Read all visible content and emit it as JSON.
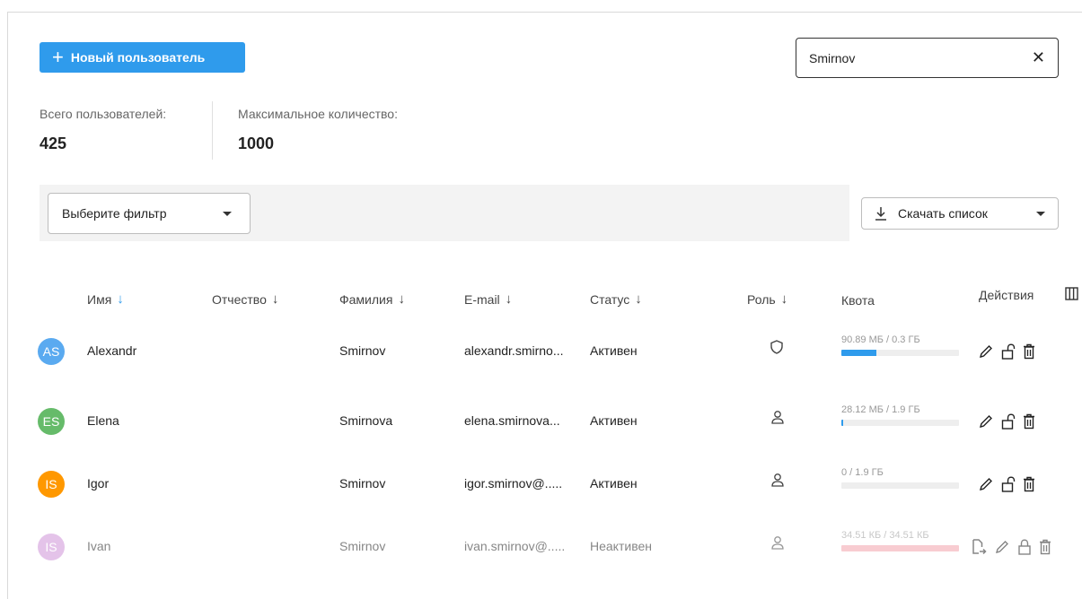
{
  "toolbar": {
    "new_user_label": "Новый пользователь"
  },
  "search": {
    "value": "Smirnov"
  },
  "stats": {
    "total_label": "Всего пользователей:",
    "total_value": "425",
    "max_label": "Максимальное количество:",
    "max_value": "1000"
  },
  "filter": {
    "placeholder": "Выберите фильтр"
  },
  "download": {
    "label": "Скачать список"
  },
  "columns": {
    "name": "Имя",
    "patronymic": "Отчество",
    "surname": "Фамилия",
    "email": "E-mail",
    "status": "Статус",
    "role": "Роль",
    "quota": "Квота",
    "actions": "Действия"
  },
  "users": [
    {
      "initials": "AS",
      "avatar_color": "#5aaaf0",
      "name": "Alexandr",
      "surname": "Smirnov",
      "email": "alexandr.smirno...",
      "status": "Активен",
      "role_icon": "shield-icon",
      "quota_text": "90.89 МБ / 0.3 ГБ",
      "quota_fraction": 0.3,
      "quota_color": "#2f9bec",
      "active": true
    },
    {
      "initials": "ES",
      "avatar_color": "#66bb6a",
      "name": "Elena",
      "surname": "Smirnova",
      "email": "elena.smirnova...",
      "status": "Активен",
      "role_icon": "user-icon",
      "quota_text": "28.12 МБ / 1.9 ГБ",
      "quota_fraction": 0.015,
      "quota_color": "#2f9bec",
      "active": true
    },
    {
      "initials": "IS",
      "avatar_color": "#ff9800",
      "name": "Igor",
      "surname": "Smirnov",
      "email": "igor.smirnov@.....",
      "status": "Активен",
      "role_icon": "user-icon",
      "quota_text": "0 / 1.9 ГБ",
      "quota_fraction": 0,
      "quota_color": "#2f9bec",
      "active": true
    },
    {
      "initials": "IS",
      "avatar_color": "#ce93d8",
      "name": "Ivan",
      "surname": "Smirnov",
      "email": "ivan.smirnov@.....",
      "status": "Неактивен",
      "role_icon": "user-icon",
      "quota_text": "34.51 КБ / 34.51 КБ",
      "quota_fraction": 1,
      "quota_color": "#f4a3ad",
      "active": false
    }
  ]
}
